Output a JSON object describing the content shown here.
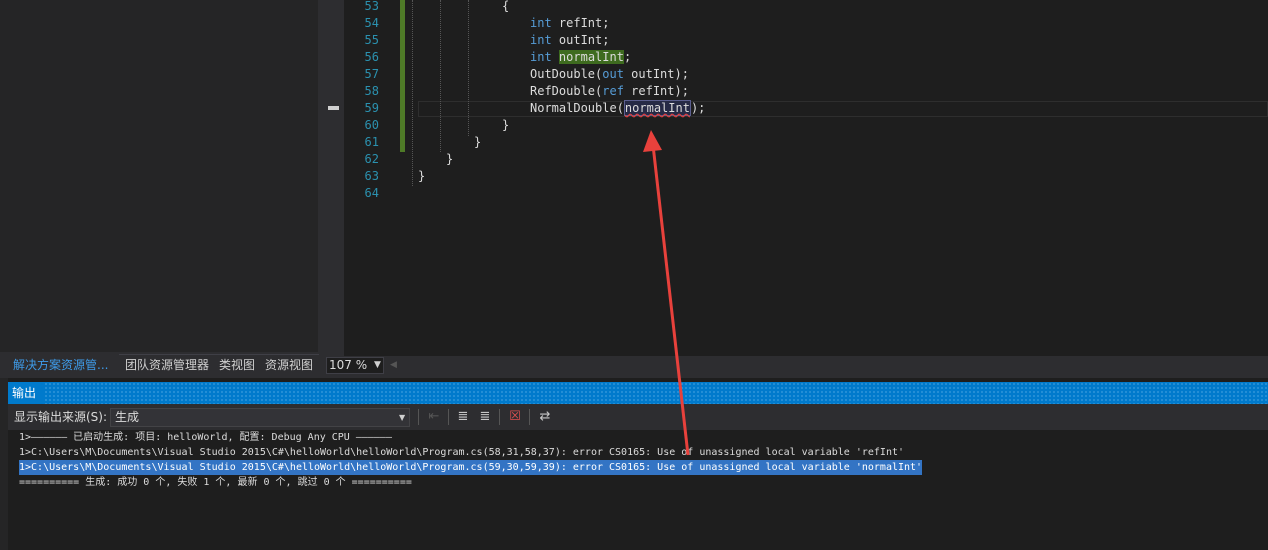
{
  "editor": {
    "lines": [
      {
        "num": "53"
      },
      {
        "num": "54"
      },
      {
        "num": "55"
      },
      {
        "num": "56"
      },
      {
        "num": "57"
      },
      {
        "num": "58"
      },
      {
        "num": "59"
      },
      {
        "num": "60"
      },
      {
        "num": "61"
      },
      {
        "num": "62"
      },
      {
        "num": "63"
      },
      {
        "num": "64"
      }
    ],
    "code": {
      "l53": "{",
      "l54_kw": "int",
      "l54_rest": " refInt;",
      "l55_kw": "int",
      "l55_rest": " outInt;",
      "l56_kw": "int",
      "l56_var": "normalInt",
      "l56_end": ";",
      "l57_a": "OutDouble(",
      "l57_kw": "out",
      "l57_b": " outInt);",
      "l58_a": "RefDouble(",
      "l58_kw": "ref",
      "l58_b": " refInt);",
      "l59_a": "NormalDouble(",
      "l59_var": "normalInt",
      "l59_b": ");",
      "l60": "}",
      "l61": "}",
      "l62": "}",
      "l63": "}"
    }
  },
  "tabs": {
    "solution": "解决方案资源管...",
    "team": "团队资源管理器",
    "class": "类视图",
    "resource": "资源视图"
  },
  "zoom": {
    "value": "107 %"
  },
  "output": {
    "title": "输出",
    "source_label": "显示输出来源(S):",
    "source_value": "生成",
    "lines": {
      "l1": "1>—————— 已启动生成: 项目: helloWorld, 配置: Debug Any CPU ——————",
      "l2": "1>C:\\Users\\M\\Documents\\Visual Studio 2015\\C#\\helloWorld\\helloWorld\\Program.cs(58,31,58,37): error CS0165: Use of unassigned local variable 'refInt'",
      "l3": "1>C:\\Users\\M\\Documents\\Visual Studio 2015\\C#\\helloWorld\\helloWorld\\Program.cs(59,30,59,39): error CS0165: Use of unassigned local variable 'normalInt'",
      "l4": "========== 生成: 成功 0 个, 失败 1 个, 最新 0 个, 跳过 0 个 =========="
    }
  },
  "colors": {
    "accent": "#007acc",
    "annotation_arrow": "#e8413c"
  }
}
